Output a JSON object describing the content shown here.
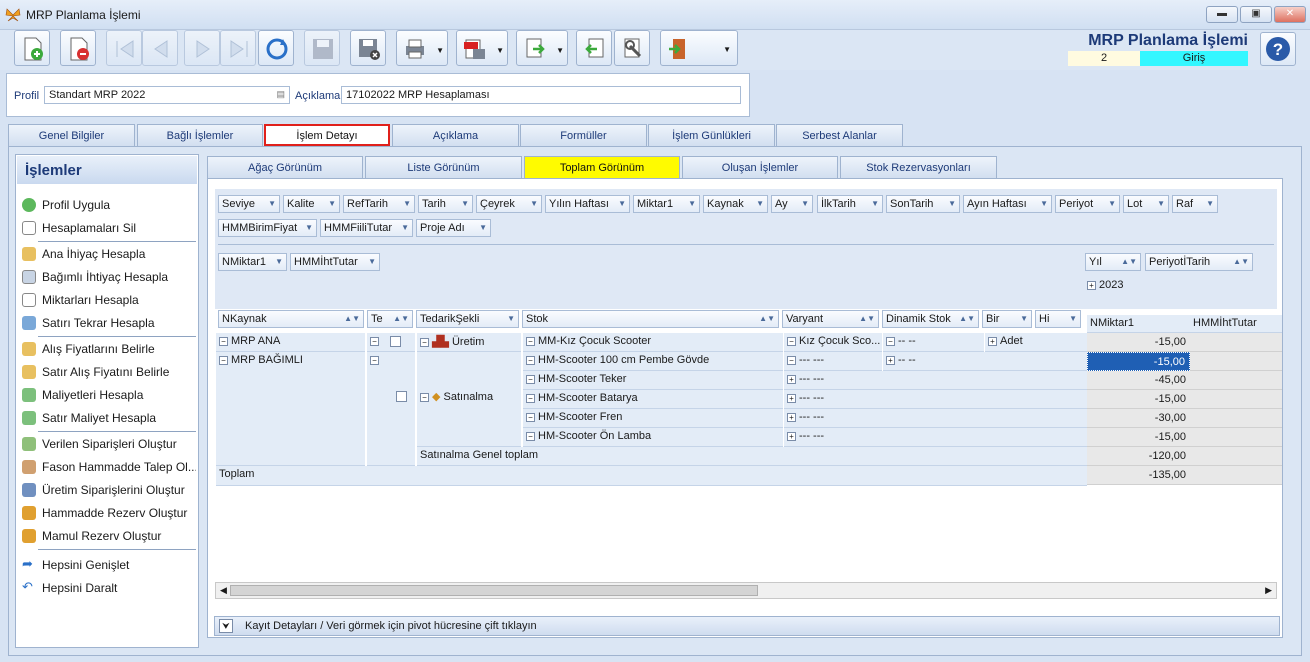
{
  "window": {
    "title": "MRP Planlama İşlemi",
    "min": "▬",
    "max": "▣",
    "close": "✕"
  },
  "header": {
    "title": "MRP Planlama İşlemi",
    "number": "2",
    "status": "Giriş",
    "status_color": "#33f7ff"
  },
  "toolbar": {
    "icons": [
      "new-doc-icon",
      "delete-doc-icon",
      "first-icon",
      "prev-icon",
      "next-icon",
      "last-icon",
      "refresh-icon",
      "save-icon",
      "cancel-save-icon",
      "print-icon",
      "pdf-icon",
      "export-icon",
      "import-icon",
      "tools-icon",
      "exit-icon"
    ]
  },
  "profile": {
    "label": "Profil",
    "value": "Standart MRP 2022",
    "desc_label": "Açıklama",
    "desc_value": "17102022 MRP Hesaplaması"
  },
  "tabs": [
    "Genel Bilgiler",
    "Bağlı İşlemler",
    "İşlem Detayı",
    "Açıklama",
    "Formüller",
    "İşlem Günlükleri",
    "Serbest Alanlar"
  ],
  "active_tab": "İşlem Detayı",
  "panel": {
    "title": "İşlemler",
    "items": [
      "Profil Uygula",
      "Hesaplamaları Sil",
      "Ana İhiyaç Hesapla",
      "Bağımlı İhtiyaç Hesapla",
      "Miktarları Hesapla",
      "Satırı Tekrar Hesapla",
      "Alış Fiyatlarını Belirle",
      "Satır Alış Fiyatını Belirle",
      "Maliyetleri Hesapla",
      "Satır Maliyet Hesapla",
      "Verilen Siparişleri Oluştur",
      "Fason Hammadde Talep Ol...",
      "Üretim Siparişlerini Oluştur",
      "Hammadde Rezerv Oluştur",
      "Mamul Rezerv Oluştur",
      "Hepsini Genişlet",
      "Hepsini Daralt"
    ]
  },
  "subtabs": [
    "Ağaç Görünüm",
    "Liste Görünüm",
    "Toplam Görünüm",
    "Oluşan İşlemler",
    "Stok Rezervasyonları"
  ],
  "active_subtab": "Toplam Görünüm",
  "pivot": {
    "filter_row1": [
      "Seviye",
      "Kalite",
      "RefTarih",
      "Tarih",
      "Çeyrek",
      "Yılın Haftası",
      "Miktar1",
      "Kaynak",
      "Ay",
      "İlkTarih",
      "SonTarih",
      "Ayın Haftası",
      "Periyot",
      "Lot",
      "Raf"
    ],
    "filter_row2": [
      "HMMBirimFiyat",
      "HMMFiiliTutar",
      "Proje Adı"
    ],
    "data_fields": [
      "NMiktar1",
      "HMMİhtTutar"
    ],
    "col_fields": [
      "Yıl",
      "PeriyotİTarih"
    ],
    "year": "2023",
    "row_headers": [
      "NKaynak",
      "Te",
      "TedarikŞekli",
      "Stok",
      "Varyant",
      "Dinamik Stok",
      "Bir",
      "Hi"
    ],
    "value_headers": [
      "NMiktar1",
      "HMMİhtTutar"
    ],
    "rows": {
      "ana": "MRP ANA",
      "bagimli": "MRP BAĞIMLI",
      "uretim": "Üretim",
      "satinalma": "Satınalma",
      "stok0": "MM-Kız Çocuk Scooter",
      "var0": "Kız Çocuk Sco...",
      "din0": "-- --",
      "bir0": "Adet",
      "stock": [
        "HM-Scooter 100 cm Pembe Gövde",
        "HM-Scooter Teker",
        "HM-Scooter Batarya",
        "HM-Scooter Fren",
        "HM-Scooter Ön Lamba"
      ],
      "dash3": "--- ---",
      "dash2": "-- --",
      "subtotal": "Satınalma Genel toplam",
      "total": "Toplam"
    },
    "values": [
      "-15,00",
      "-15,00",
      "-45,00",
      "-15,00",
      "-30,00",
      "-15,00",
      "-120,00",
      "-135,00"
    ]
  },
  "footer": {
    "text": "Kayıt Detayları / Veri görmek için pivot hücresine çift tıklayın"
  }
}
